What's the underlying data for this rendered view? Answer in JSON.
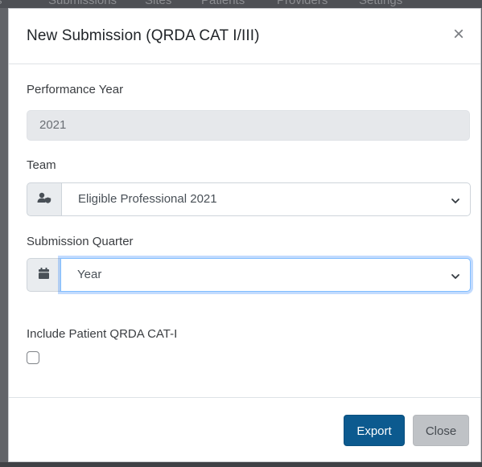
{
  "background_nav": {
    "items": [
      "rts",
      "Submissions",
      "Sites",
      "Patients",
      "Providers",
      "Settings"
    ]
  },
  "modal": {
    "title": "New Submission (QRDA CAT I/III)",
    "close_glyph": "×",
    "performance_year": {
      "label": "Performance Year",
      "value": "2021"
    },
    "team": {
      "label": "Team",
      "icon": "user-shield-icon",
      "selected": "Eligible Professional 2021"
    },
    "submission_quarter": {
      "label": "Submission Quarter",
      "icon": "calendar-icon",
      "selected": "Year"
    },
    "include_patient": {
      "label": "Include Patient QRDA CAT-I",
      "checked": false
    },
    "buttons": {
      "export": "Export",
      "close": "Close"
    }
  },
  "colors": {
    "primary": "#0c5a8f",
    "secondary": "#bfc2c6",
    "focus": "#80bdff"
  }
}
